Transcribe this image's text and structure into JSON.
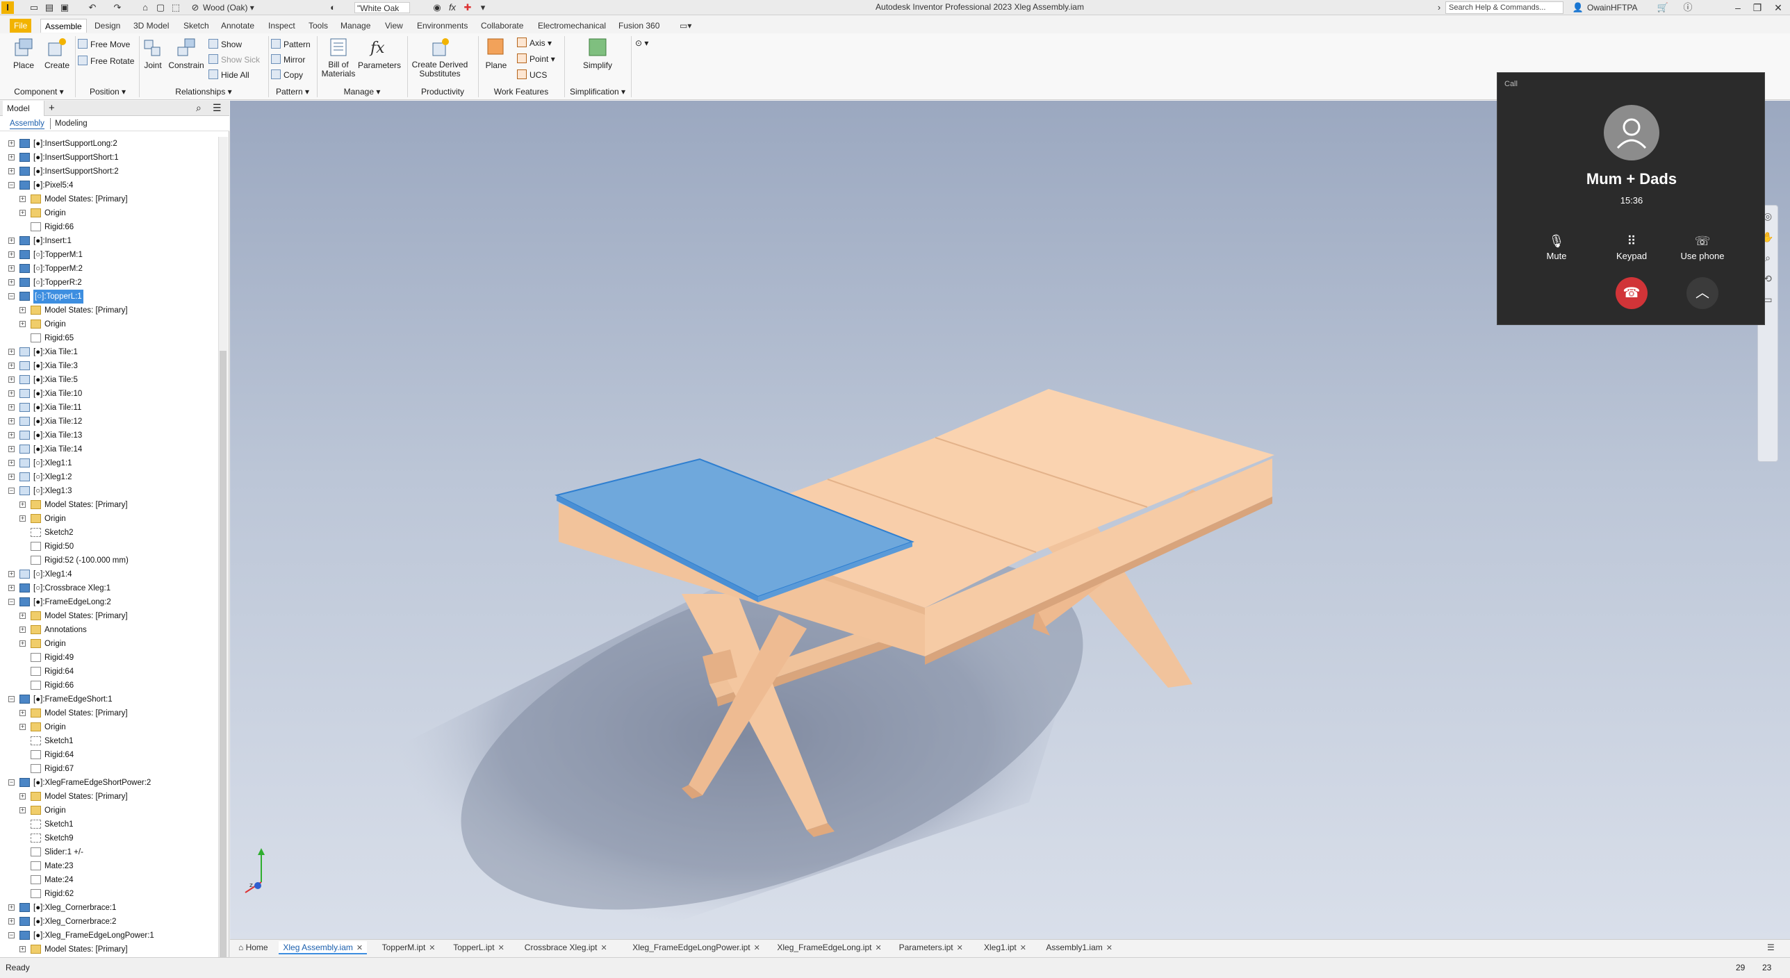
{
  "titlebar": {
    "app_icon": "I",
    "material": "Wood (Oak)",
    "appearance": "\"White Oak",
    "title": "Autodesk Inventor Professional 2023   Xleg Assembly.iam",
    "search_placeholder": "Search Help & Commands...",
    "user": "OwainHFTPA",
    "icons": [
      "new-icon",
      "open-icon",
      "save-icon",
      "undo-icon",
      "redo-icon",
      "home-icon",
      "select-icon",
      "material-icon",
      "appearance-icon",
      "fx-icon",
      "plus-icon",
      "cart-icon",
      "help-icon"
    ]
  },
  "menu": {
    "tabs": [
      "File",
      "Assemble",
      "Design",
      "3D Model",
      "Sketch",
      "Annotate",
      "Inspect",
      "Tools",
      "Manage",
      "View",
      "Environments",
      "Collaborate",
      "Electromechanical",
      "Fusion 360"
    ],
    "active": "Assemble"
  },
  "ribbon": {
    "place": "Place",
    "create": "Create",
    "free_move": "Free Move",
    "free_rotate": "Free Rotate",
    "joint": "Joint",
    "constrain": "Constrain",
    "show": "Show",
    "show_sick": "Show Sick",
    "hide_all": "Hide All",
    "pattern": "Pattern",
    "mirror": "Mirror",
    "copy": "Copy",
    "bom": "Bill of\nMaterials",
    "bom_line1": "Bill of",
    "bom_line2": "Materials",
    "parameters": "Parameters",
    "create_derived_line1": "Create Derived",
    "create_derived_line2": "Substitutes",
    "plane": "Plane",
    "axis": "Axis",
    "point": "Point",
    "ucs": "UCS",
    "simplify": "Simplify",
    "panels": {
      "component": "Component ▾",
      "position": "Position ▾",
      "relationships": "Relationships ▾",
      "pattern": "Pattern ▾",
      "manage": "Manage ▾",
      "productivity": "Productivity",
      "work_features": "Work Features",
      "simplification": "Simplification ▾"
    }
  },
  "browser": {
    "tab": "Model",
    "close": "✕",
    "add": "+",
    "subtab_assembly": "Assembly",
    "subtab_modeling": "Modeling",
    "rows": [
      {
        "label": "[●]:InsertSupportLong:2",
        "depth": 0,
        "expander": "+",
        "icon": "part"
      },
      {
        "label": "[●]:InsertSupportShort:1",
        "depth": 0,
        "expander": "+",
        "icon": "part"
      },
      {
        "label": "[●]:InsertSupportShort:2",
        "depth": 0,
        "expander": "+",
        "icon": "part"
      },
      {
        "label": "[●]:Pixel5:4",
        "depth": 0,
        "expander": "−",
        "icon": "part"
      },
      {
        "label": "Model States: [Primary]",
        "depth": 1,
        "expander": "+",
        "icon": "folder"
      },
      {
        "label": "Origin",
        "depth": 1,
        "expander": "+",
        "icon": "folder"
      },
      {
        "label": "Rigid:66",
        "depth": 1,
        "expander": "",
        "icon": "con"
      },
      {
        "label": "[●]:Insert:1",
        "depth": 0,
        "expander": "+",
        "icon": "part"
      },
      {
        "label": "[○]:TopperM:1",
        "depth": 0,
        "expander": "+",
        "icon": "part"
      },
      {
        "label": "[○]:TopperM:2",
        "depth": 0,
        "expander": "+",
        "icon": "part"
      },
      {
        "label": "[○]:TopperR:2",
        "depth": 0,
        "expander": "+",
        "icon": "part"
      },
      {
        "label": "[○]:TopperL:1",
        "depth": 0,
        "expander": "−",
        "icon": "part",
        "selected": true
      },
      {
        "label": "Model States: [Primary]",
        "depth": 1,
        "expander": "+",
        "icon": "folder"
      },
      {
        "label": "Origin",
        "depth": 1,
        "expander": "+",
        "icon": "folder"
      },
      {
        "label": "Rigid:65",
        "depth": 1,
        "expander": "",
        "icon": "con"
      },
      {
        "label": "[●]:Xia Tile:1",
        "depth": 0,
        "expander": "+",
        "icon": "asm"
      },
      {
        "label": "[●]:Xia Tile:3",
        "depth": 0,
        "expander": "+",
        "icon": "asm"
      },
      {
        "label": "[●]:Xia Tile:5",
        "depth": 0,
        "expander": "+",
        "icon": "asm"
      },
      {
        "label": "[●]:Xia Tile:10",
        "depth": 0,
        "expander": "+",
        "icon": "asm"
      },
      {
        "label": "[●]:Xia Tile:11",
        "depth": 0,
        "expander": "+",
        "icon": "asm"
      },
      {
        "label": "[●]:Xia Tile:12",
        "depth": 0,
        "expander": "+",
        "icon": "asm"
      },
      {
        "label": "[●]:Xia Tile:13",
        "depth": 0,
        "expander": "+",
        "icon": "asm"
      },
      {
        "label": "[●]:Xia Tile:14",
        "depth": 0,
        "expander": "+",
        "icon": "asm"
      },
      {
        "label": "[○]:Xleg1:1",
        "depth": 0,
        "expander": "+",
        "icon": "asm"
      },
      {
        "label": "[○]:Xleg1:2",
        "depth": 0,
        "expander": "+",
        "icon": "asm"
      },
      {
        "label": "[○]:Xleg1:3",
        "depth": 0,
        "expander": "−",
        "icon": "asm"
      },
      {
        "label": "Model States: [Primary]",
        "depth": 1,
        "expander": "+",
        "icon": "folder"
      },
      {
        "label": "Origin",
        "depth": 1,
        "expander": "+",
        "icon": "folder"
      },
      {
        "label": "Sketch2",
        "depth": 1,
        "expander": "",
        "icon": "sk"
      },
      {
        "label": "Rigid:50",
        "depth": 1,
        "expander": "",
        "icon": "con"
      },
      {
        "label": "Rigid:52 (-100.000 mm)",
        "depth": 1,
        "expander": "",
        "icon": "con"
      },
      {
        "label": "[○]:Xleg1:4",
        "depth": 0,
        "expander": "+",
        "icon": "asm"
      },
      {
        "label": "[○]:Crossbrace Xleg:1",
        "depth": 0,
        "expander": "+",
        "icon": "part"
      },
      {
        "label": "[●]:FrameEdgeLong:2",
        "depth": 0,
        "expander": "−",
        "icon": "part"
      },
      {
        "label": "Model States: [Primary]",
        "depth": 1,
        "expander": "+",
        "icon": "folder"
      },
      {
        "label": "Annotations",
        "depth": 1,
        "expander": "+",
        "icon": "folder"
      },
      {
        "label": "Origin",
        "depth": 1,
        "expander": "+",
        "icon": "folder"
      },
      {
        "label": "Rigid:49",
        "depth": 1,
        "expander": "",
        "icon": "con"
      },
      {
        "label": "Rigid:64",
        "depth": 1,
        "expander": "",
        "icon": "con"
      },
      {
        "label": "Rigid:66",
        "depth": 1,
        "expander": "",
        "icon": "con"
      },
      {
        "label": "[●]:FrameEdgeShort:1",
        "depth": 0,
        "expander": "−",
        "icon": "part"
      },
      {
        "label": "Model States: [Primary]",
        "depth": 1,
        "expander": "+",
        "icon": "folder"
      },
      {
        "label": "Origin",
        "depth": 1,
        "expander": "+",
        "icon": "folder"
      },
      {
        "label": "Sketch1",
        "depth": 1,
        "expander": "",
        "icon": "sk"
      },
      {
        "label": "Rigid:64",
        "depth": 1,
        "expander": "",
        "icon": "con"
      },
      {
        "label": "Rigid:67",
        "depth": 1,
        "expander": "",
        "icon": "con"
      },
      {
        "label": "[●]:XlegFrameEdgeShortPower:2",
        "depth": 0,
        "expander": "−",
        "icon": "part"
      },
      {
        "label": "Model States: [Primary]",
        "depth": 1,
        "expander": "+",
        "icon": "folder"
      },
      {
        "label": "Origin",
        "depth": 1,
        "expander": "+",
        "icon": "folder"
      },
      {
        "label": "Sketch1",
        "depth": 1,
        "expander": "",
        "icon": "sk"
      },
      {
        "label": "Sketch9",
        "depth": 1,
        "expander": "",
        "icon": "sk"
      },
      {
        "label": "Slider:1 +/-",
        "depth": 1,
        "expander": "",
        "icon": "con"
      },
      {
        "label": "Mate:23",
        "depth": 1,
        "expander": "",
        "icon": "con"
      },
      {
        "label": "Mate:24",
        "depth": 1,
        "expander": "",
        "icon": "con"
      },
      {
        "label": "Rigid:62",
        "depth": 1,
        "expander": "",
        "icon": "con"
      },
      {
        "label": "[●]:Xleg_Cornerbrace:1",
        "depth": 0,
        "expander": "+",
        "icon": "part"
      },
      {
        "label": "[●]:Xleg_Cornerbrace:2",
        "depth": 0,
        "expander": "+",
        "icon": "part"
      },
      {
        "label": "[●]:Xleg_FrameEdgeLongPower:1",
        "depth": 0,
        "expander": "−",
        "icon": "part"
      },
      {
        "label": "Model States: [Primary]",
        "depth": 1,
        "expander": "+",
        "icon": "folder"
      }
    ]
  },
  "call": {
    "header": "Call",
    "name": "Mum + Dads",
    "time": "15:36",
    "mute": "Mute",
    "keypad": "Keypad",
    "use_phone": "Use phone"
  },
  "doc_tabs": [
    {
      "label": "Home",
      "closable": false
    },
    {
      "label": "Xleg Assembly.iam",
      "closable": true,
      "active": true
    },
    {
      "label": "TopperM.ipt",
      "closable": true
    },
    {
      "label": "TopperL.ipt",
      "closable": true
    },
    {
      "label": "Crossbrace Xleg.ipt",
      "closable": true
    },
    {
      "label": "Xleg_FrameEdgeLongPower.ipt",
      "closable": true
    },
    {
      "label": "Xleg_FrameEdgeLong.ipt",
      "closable": true
    },
    {
      "label": "Parameters.ipt",
      "closable": true
    },
    {
      "label": "Xleg1.ipt",
      "closable": true
    },
    {
      "label": "Assembly1.iam",
      "closable": true
    }
  ],
  "status": {
    "text": "Ready",
    "count1": "29",
    "count2": "23"
  },
  "colors": {
    "file_tab": "#f2b300",
    "selection": "#6fa8dc",
    "wood": "#f6c9a2",
    "hangup": "#d13438"
  }
}
